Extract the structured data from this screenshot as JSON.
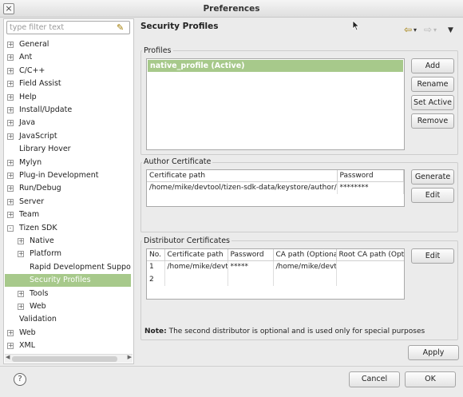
{
  "window": {
    "title": "Preferences",
    "close_icon": "close-icon"
  },
  "filter": {
    "placeholder": "type filter text",
    "value": ""
  },
  "tree": [
    {
      "label": "General",
      "depth": 0,
      "expander": "+",
      "selected": false
    },
    {
      "label": "Ant",
      "depth": 0,
      "expander": "+",
      "selected": false
    },
    {
      "label": "C/C++",
      "depth": 0,
      "expander": "+",
      "selected": false
    },
    {
      "label": "Field Assist",
      "depth": 0,
      "expander": "+",
      "selected": false
    },
    {
      "label": "Help",
      "depth": 0,
      "expander": "+",
      "selected": false
    },
    {
      "label": "Install/Update",
      "depth": 0,
      "expander": "+",
      "selected": false
    },
    {
      "label": "Java",
      "depth": 0,
      "expander": "+",
      "selected": false
    },
    {
      "label": "JavaScript",
      "depth": 0,
      "expander": "+",
      "selected": false
    },
    {
      "label": "Library Hover",
      "depth": 0,
      "expander": "",
      "selected": false
    },
    {
      "label": "Mylyn",
      "depth": 0,
      "expander": "+",
      "selected": false
    },
    {
      "label": "Plug-in Development",
      "depth": 0,
      "expander": "+",
      "selected": false
    },
    {
      "label": "Run/Debug",
      "depth": 0,
      "expander": "+",
      "selected": false
    },
    {
      "label": "Server",
      "depth": 0,
      "expander": "+",
      "selected": false
    },
    {
      "label": "Team",
      "depth": 0,
      "expander": "+",
      "selected": false
    },
    {
      "label": "Tizen SDK",
      "depth": 0,
      "expander": "-",
      "selected": false
    },
    {
      "label": "Native",
      "depth": 1,
      "expander": "+",
      "selected": false
    },
    {
      "label": "Platform",
      "depth": 1,
      "expander": "+",
      "selected": false
    },
    {
      "label": "Rapid Development Support",
      "depth": 1,
      "expander": "",
      "selected": false
    },
    {
      "label": "Security Profiles",
      "depth": 1,
      "expander": "",
      "selected": true
    },
    {
      "label": "Tools",
      "depth": 1,
      "expander": "+",
      "selected": false
    },
    {
      "label": "Web",
      "depth": 1,
      "expander": "+",
      "selected": false
    },
    {
      "label": "Validation",
      "depth": 0,
      "expander": "",
      "selected": false
    },
    {
      "label": "Web",
      "depth": 0,
      "expander": "+",
      "selected": false
    },
    {
      "label": "XML",
      "depth": 0,
      "expander": "+",
      "selected": false
    }
  ],
  "page": {
    "title": "Security Profiles"
  },
  "profiles": {
    "label": "Profiles",
    "items": [
      "native_profile (Active)"
    ],
    "buttons": {
      "add": "Add",
      "rename": "Rename",
      "set_active": "Set Active",
      "remove": "Remove"
    }
  },
  "author": {
    "label": "Author Certificate",
    "columns": [
      "Certificate path",
      "Password"
    ],
    "rows": [
      [
        "/home/mike/devtool/tizen-sdk-data/keystore/author/de",
        "********"
      ]
    ],
    "buttons": {
      "generate": "Generate",
      "edit": "Edit"
    }
  },
  "distributor": {
    "label": "Distributor Certificates",
    "columns": [
      "No.",
      "Certificate path",
      "Password",
      "CA path (Optiona",
      "Root CA path (Opt"
    ],
    "rows": [
      [
        "1",
        "/home/mike/devt",
        "*****",
        "/home/mike/devt",
        ""
      ],
      [
        "2",
        "",
        "",
        "",
        ""
      ]
    ],
    "buttons": {
      "edit": "Edit"
    }
  },
  "note": {
    "prefix": "Note:",
    "text": " The second distributor is optional and is used only for special purposes"
  },
  "footer": {
    "apply": "Apply",
    "cancel": "Cancel",
    "ok": "OK",
    "help_icon": "help-icon"
  },
  "colors": {
    "selection": "#a7c98b",
    "window_bg": "#ebebeb"
  }
}
